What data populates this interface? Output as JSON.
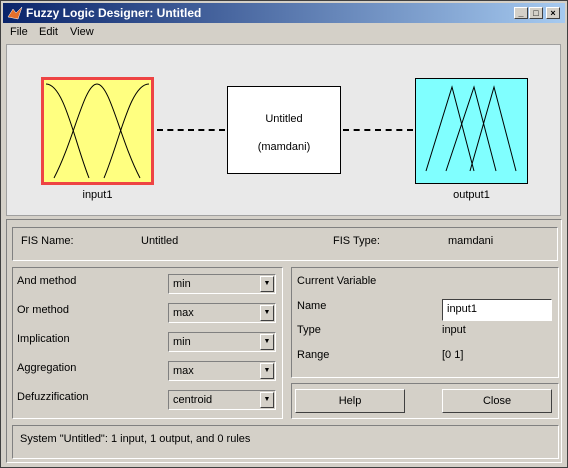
{
  "window": {
    "title": "Fuzzy Logic Designer: Untitled"
  },
  "titlebar_buttons": {
    "minimize": "_",
    "maximize": "□",
    "close": "×"
  },
  "menu": {
    "file": "File",
    "edit": "Edit",
    "view": "View"
  },
  "diagram": {
    "input_label": "input1",
    "output_label": "output1",
    "system_name": "Untitled",
    "system_type": "(mamdani)"
  },
  "fis_info": {
    "name_label": "FIS Name:",
    "name_value": "Untitled",
    "type_label": "FIS Type:",
    "type_value": "mamdani"
  },
  "methods": {
    "and_label": "And method",
    "and_value": "min",
    "or_label": "Or method",
    "or_value": "max",
    "implication_label": "Implication",
    "implication_value": "min",
    "aggregation_label": "Aggregation",
    "aggregation_value": "max",
    "defuzz_label": "Defuzzification",
    "defuzz_value": "centroid"
  },
  "current_variable": {
    "heading": "Current Variable",
    "name_label": "Name",
    "name_value": "input1",
    "type_label": "Type",
    "type_value": "input",
    "range_label": "Range",
    "range_value": "[0 1]"
  },
  "buttons": {
    "help": "Help",
    "close": "Close"
  },
  "status": "System \"Untitled\": 1 input, 1 output, and 0 rules",
  "colors": {
    "input_fill": "#ffff80",
    "input_border": "#ee4444",
    "output_fill": "#80ffff",
    "titlebar_start": "#0a246a",
    "titlebar_end": "#a6caf0"
  }
}
